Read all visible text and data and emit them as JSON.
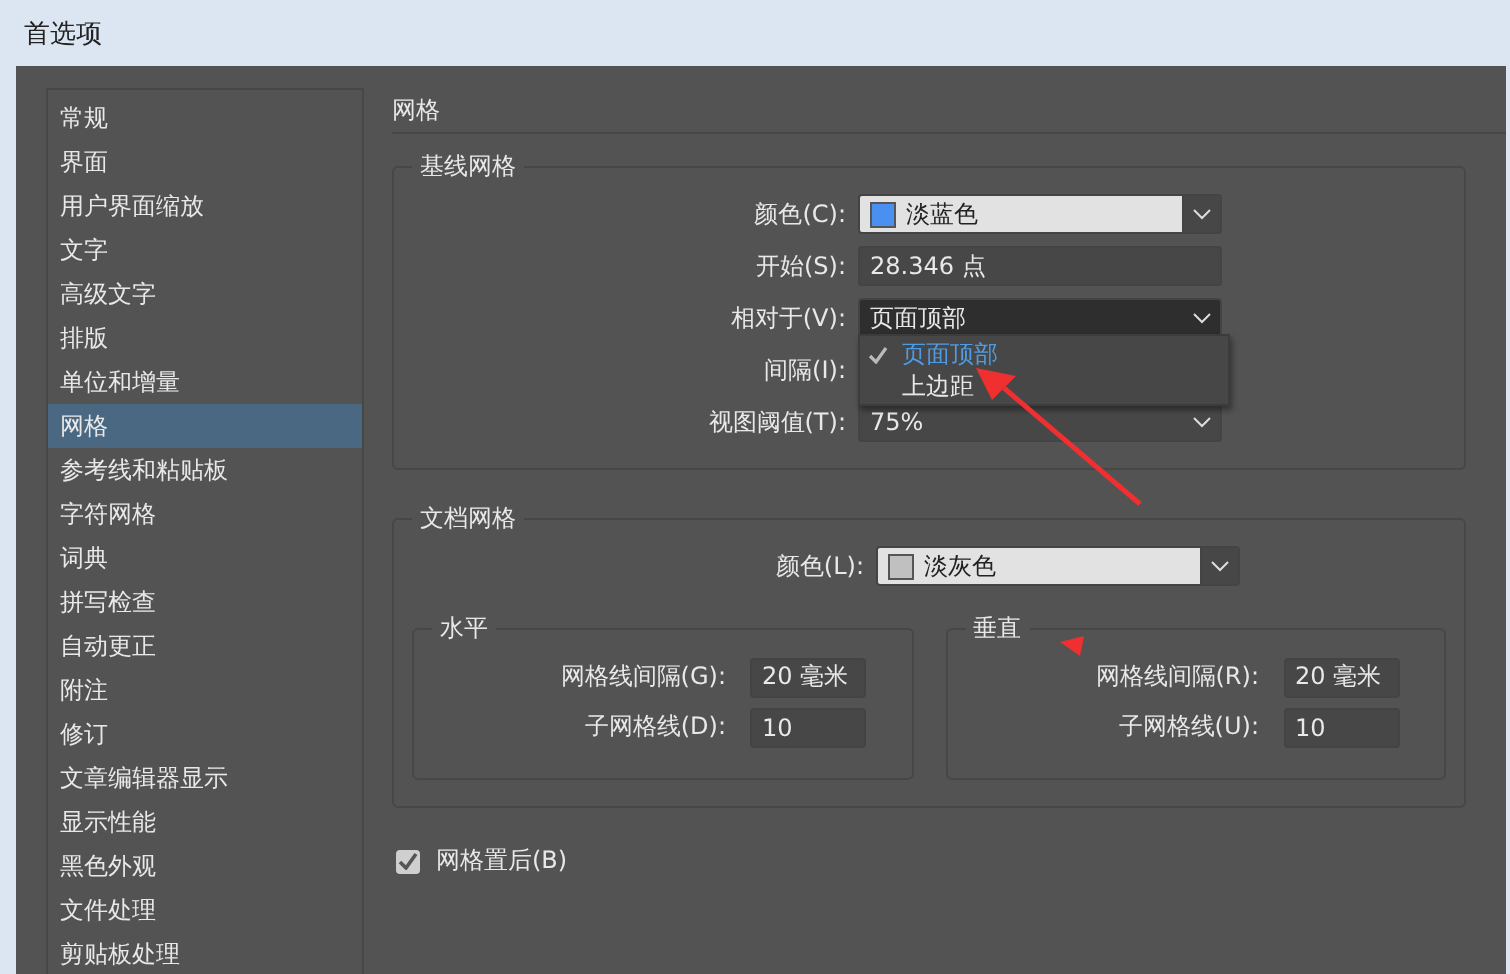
{
  "window": {
    "title": "首选项"
  },
  "sidebar": {
    "items": [
      {
        "label": "常规",
        "selected": false
      },
      {
        "label": "界面",
        "selected": false
      },
      {
        "label": "用户界面缩放",
        "selected": false
      },
      {
        "label": "文字",
        "selected": false
      },
      {
        "label": "高级文字",
        "selected": false
      },
      {
        "label": "排版",
        "selected": false
      },
      {
        "label": "单位和增量",
        "selected": false
      },
      {
        "label": "网格",
        "selected": true
      },
      {
        "label": "参考线和粘贴板",
        "selected": false
      },
      {
        "label": "字符网格",
        "selected": false
      },
      {
        "label": "词典",
        "selected": false
      },
      {
        "label": "拼写检查",
        "selected": false
      },
      {
        "label": "自动更正",
        "selected": false
      },
      {
        "label": "附注",
        "selected": false
      },
      {
        "label": "修订",
        "selected": false
      },
      {
        "label": "文章编辑器显示",
        "selected": false
      },
      {
        "label": "显示性能",
        "selected": false
      },
      {
        "label": "黑色外观",
        "selected": false
      },
      {
        "label": "文件处理",
        "selected": false
      },
      {
        "label": "剪贴板处理",
        "selected": false
      }
    ]
  },
  "section_title": "网格",
  "baseline_grid": {
    "title": "基线网格",
    "rows": [
      {
        "kind": "color",
        "label": "颜色(C):",
        "value": "淡蓝色",
        "color": "#4a90f0"
      },
      {
        "kind": "input",
        "label": "开始(S):",
        "value": "28.346 点"
      },
      {
        "kind": "dropdown",
        "label": "相对于(V):",
        "value": "页面顶部",
        "expanded": true
      },
      {
        "kind": "hidden",
        "label": "间隔(I):"
      },
      {
        "kind": "dropdown",
        "label": "视图阈值(T):",
        "value": "75%",
        "expanded": false
      }
    ],
    "menu": [
      {
        "label": "页面顶部",
        "selected": true
      },
      {
        "label": "上边距",
        "selected": false
      }
    ]
  },
  "document_grid": {
    "title": "文档网格",
    "color_row": {
      "label": "颜色(L):",
      "value": "淡灰色",
      "color": "#c0c0c0"
    },
    "groups": [
      {
        "title": "水平",
        "rows": [
          {
            "label": "网格线间隔(G):",
            "value": "20 毫米"
          },
          {
            "label": "子网格线(D):",
            "value": "10"
          }
        ]
      },
      {
        "title": "垂直",
        "rows": [
          {
            "label": "网格线间隔(R):",
            "value": "20 毫米"
          },
          {
            "label": "子网格线(U):",
            "value": "10"
          }
        ]
      }
    ]
  },
  "grids_in_back": {
    "label": "网格置后(B)",
    "checked": true
  }
}
